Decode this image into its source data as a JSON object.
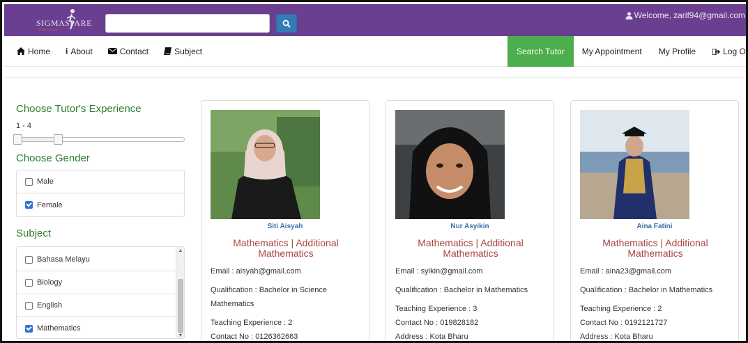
{
  "header": {
    "logo_text": "SIGMASPARE",
    "logo_sub": "HOME TUITION",
    "search_placeholder": "",
    "welcome": "Welcome, zarif94@gmail.com"
  },
  "nav": {
    "left": [
      {
        "label": "Home",
        "icon": "home-icon"
      },
      {
        "label": "About",
        "icon": "info-icon"
      },
      {
        "label": "Contact",
        "icon": "envelope-icon"
      },
      {
        "label": "Subject",
        "icon": "book-icon"
      }
    ],
    "right": [
      {
        "label": "Search Tutor",
        "active": true
      },
      {
        "label": "My Appointment"
      },
      {
        "label": "My Profile"
      },
      {
        "label": "Log Out",
        "icon": "logout-icon"
      }
    ]
  },
  "sidebar": {
    "experience_heading": "Choose Tutor's Experience",
    "experience_range": "1 - 4",
    "experience_min": 1,
    "experience_max": 4,
    "gender_heading": "Choose Gender",
    "genders": [
      {
        "label": "Male",
        "checked": false
      },
      {
        "label": "Female",
        "checked": true
      }
    ],
    "subject_heading": "Subject",
    "subjects": [
      {
        "label": "Bahasa Melayu",
        "checked": false
      },
      {
        "label": "Biology",
        "checked": false
      },
      {
        "label": "English",
        "checked": false
      },
      {
        "label": "Mathematics",
        "checked": true
      }
    ]
  },
  "tutors": [
    {
      "name": "Siti Aisyah",
      "subjects": "Mathematics | Additional Mathematics",
      "email": "Email : aisyah@gmail.com",
      "qualification": "Qualification : Bachelor in Science Mathematics",
      "experience": "Teaching Experience : 2",
      "contact": "Contact No : 0126362663",
      "address": ""
    },
    {
      "name": "Nur Asyikin",
      "subjects": "Mathematics | Additional Mathematics",
      "email": "Email : syikin@gmail.com",
      "qualification": "Qualification : Bachelor in Mathematics",
      "experience": "Teaching Experience : 3",
      "contact": "Contact No : 019828182",
      "address": "Address : Kota Bharu"
    },
    {
      "name": "Aina Fatini",
      "subjects": "Mathematics | Additional Mathematics",
      "email": "Email : aina23@gmail.com",
      "qualification": "Qualification : Bachelor in Mathematics",
      "experience": "Teaching Experience : 2",
      "contact": "Contact No : 0192121727",
      "address": "Address : Kota Bharu"
    }
  ],
  "colors": {
    "topbar": "#6a3f8f",
    "active_nav": "#4cae4c",
    "heading_green": "#2f7d2f",
    "subject_red": "#a94442",
    "name_blue": "#3a6fa8",
    "search_button": "#337ab7"
  }
}
